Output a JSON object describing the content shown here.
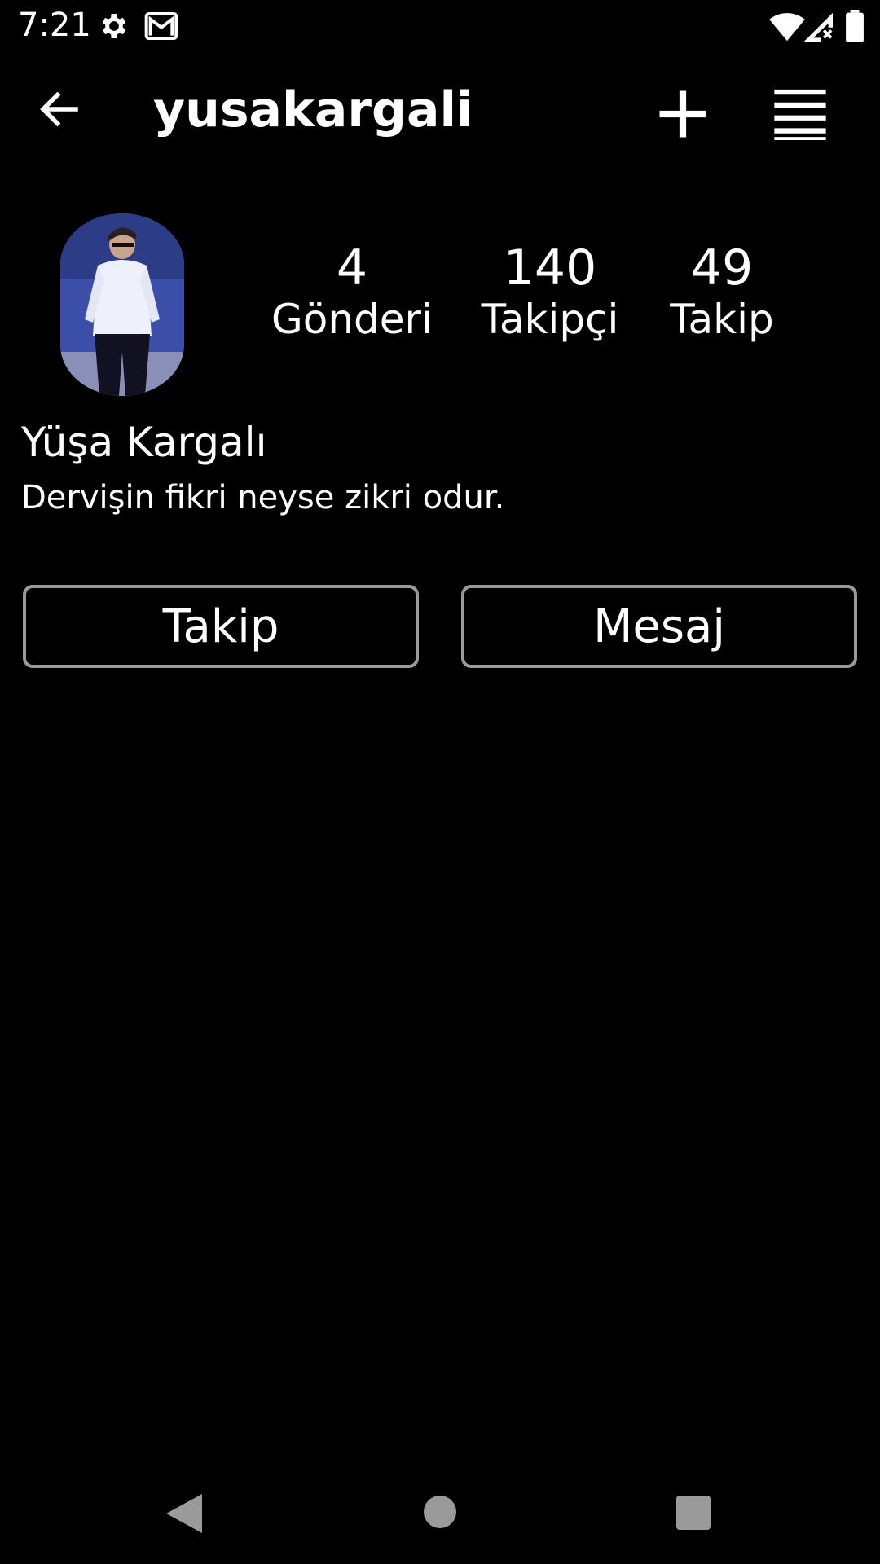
{
  "status_bar": {
    "time": "7:21",
    "icons": [
      "gear-icon",
      "gmail-icon",
      "wifi-icon",
      "signal-icon",
      "battery-icon"
    ]
  },
  "app_bar": {
    "username": "yusakargali",
    "icons": [
      "back-arrow-icon",
      "plus-icon",
      "hamburger-menu-icon"
    ]
  },
  "profile": {
    "full_name": "Yüşa Kargalı",
    "bio": "Dervişin fikri neyse zikri odur.",
    "stats": {
      "posts": {
        "count": "4",
        "label": "Gönderi"
      },
      "followers": {
        "count": "140",
        "label": "Takipçi"
      },
      "following": {
        "count": "49",
        "label": "Takip"
      }
    }
  },
  "actions": {
    "follow_label": "Takip",
    "message_label": "Mesaj"
  },
  "nav_bar": {
    "icons": [
      "nav-back-icon",
      "nav-home-icon",
      "nav-recents-icon"
    ]
  },
  "colors": {
    "background": "#000000",
    "text": "#ffffff",
    "button_border": "#9a9a9a"
  }
}
